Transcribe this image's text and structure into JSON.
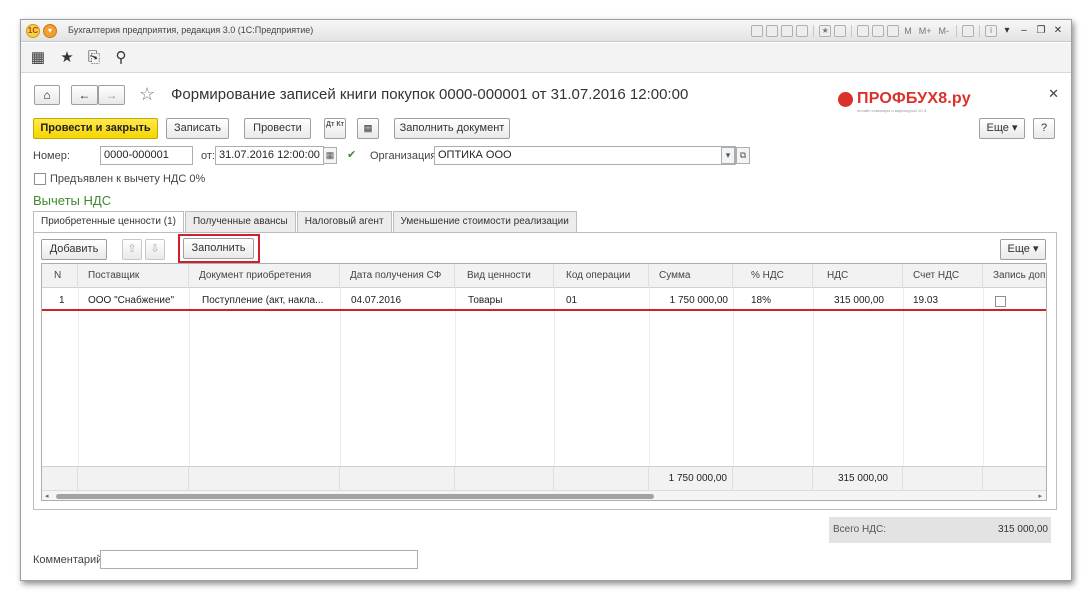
{
  "window": {
    "title": "Бухгалтерия предприятия, редакция 3.0  (1С:Предприятие)",
    "logo_text": "1С",
    "memory_buttons": [
      "M",
      "M+",
      "M-"
    ]
  },
  "form": {
    "title": "Формирование записей книги покупок 0000-000001 от 31.07.2016 12:00:00",
    "brand": "ПРОФБУХ8.ру",
    "brand_sub": "онлайн семинары и видеокурсы 1С 8"
  },
  "toolbar": {
    "post_close": "Провести и закрыть",
    "save": "Записать",
    "post": "Провести",
    "dt_kt": "Дт Кт",
    "fill_doc": "Заполнить документ",
    "more": "Еще",
    "help": "?"
  },
  "fields": {
    "number_label": "Номер:",
    "number_value": "0000-000001",
    "date_label": "от:",
    "date_value": "31.07.2016 12:00:00",
    "org_label": "Организация:",
    "org_value": "ОПТИКА ООО",
    "vat0_label": "Предъявлен к вычету НДС 0%"
  },
  "section_title": "Вычеты НДС",
  "tabs": [
    {
      "label": "Приобретенные ценности (1)"
    },
    {
      "label": "Полученные авансы"
    },
    {
      "label": "Налоговый агент"
    },
    {
      "label": "Уменьшение стоимости реализации"
    }
  ],
  "table_toolbar": {
    "add": "Добавить",
    "fill": "Заполнить",
    "more": "Еще"
  },
  "table": {
    "headers": [
      "N",
      "Поставщик",
      "Документ приобретения",
      "Дата получения СФ",
      "Вид ценности",
      "Код операции",
      "Сумма",
      "% НДС",
      "НДС",
      "Счет НДС",
      "Запись доп"
    ],
    "rows": [
      {
        "n": "1",
        "supplier": "ООО \"Снабжение\"",
        "doc": "Поступление (акт, накла...",
        "date": "04.07.2016",
        "kind": "Товары",
        "code": "01",
        "sum": "1 750 000,00",
        "rate": "18%",
        "vat": "315 000,00",
        "account": "19.03"
      }
    ],
    "footer": {
      "sum": "1 750 000,00",
      "vat": "315 000,00"
    }
  },
  "total_vat": {
    "label": "Всего НДС:",
    "value": "315 000,00"
  },
  "comment_label": "Комментарий:",
  "comment_value": ""
}
